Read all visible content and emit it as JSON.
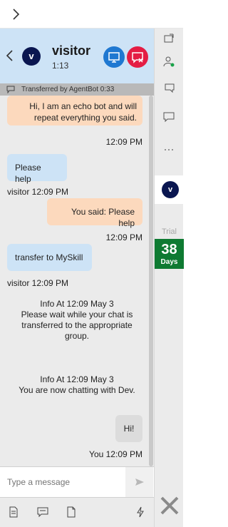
{
  "header": {
    "avatar_initial": "v",
    "visitor_name": "visitor",
    "timer": "1:13"
  },
  "transfer_bar": {
    "text": "Transferred  by  AgentBot 0:33"
  },
  "messages": {
    "m1_text": "Hi, I am an echo bot and will repeat everything you said.",
    "m1_time": "12:09 PM",
    "m2_text": "Please help",
    "m2_meta": "visitor 12:09 PM",
    "m3_text": "You said: Please help",
    "m3_time": "12:09 PM",
    "m4_text": "transfer to MySkill",
    "m4_meta": "visitor 12:09 PM",
    "info1_title": "Info At 12:09 May 3",
    "info1_body": "Please wait while your chat is transferred to the appropriate group.",
    "info2_title": "Info At 12:09 May 3",
    "info2_body": "You are now chatting with Dev.",
    "m5_text": "Hi!",
    "m5_meta": "You 12:09 PM"
  },
  "composer": {
    "placeholder": "Type a message"
  },
  "rail": {
    "avatar_initial": "v",
    "trial_label": "Trial",
    "trial_days": "38",
    "trial_unit": "Days"
  },
  "icons": {
    "expand": "chevron-right-icon",
    "back": "chevron-left-icon",
    "screen_share": "monitor-icon",
    "end_chat": "end-chat-icon",
    "send": "send-icon",
    "close": "close-x-icon"
  },
  "colors": {
    "header_bg": "#cde3f6",
    "bot_bubble": "#fcd9bd",
    "visitor_bubble": "#cde3f6",
    "screen_share_button": "#1f78d1",
    "end_chat_button": "#e41d44",
    "trial_badge": "#0e7a32",
    "avatar": "#0a1650"
  }
}
